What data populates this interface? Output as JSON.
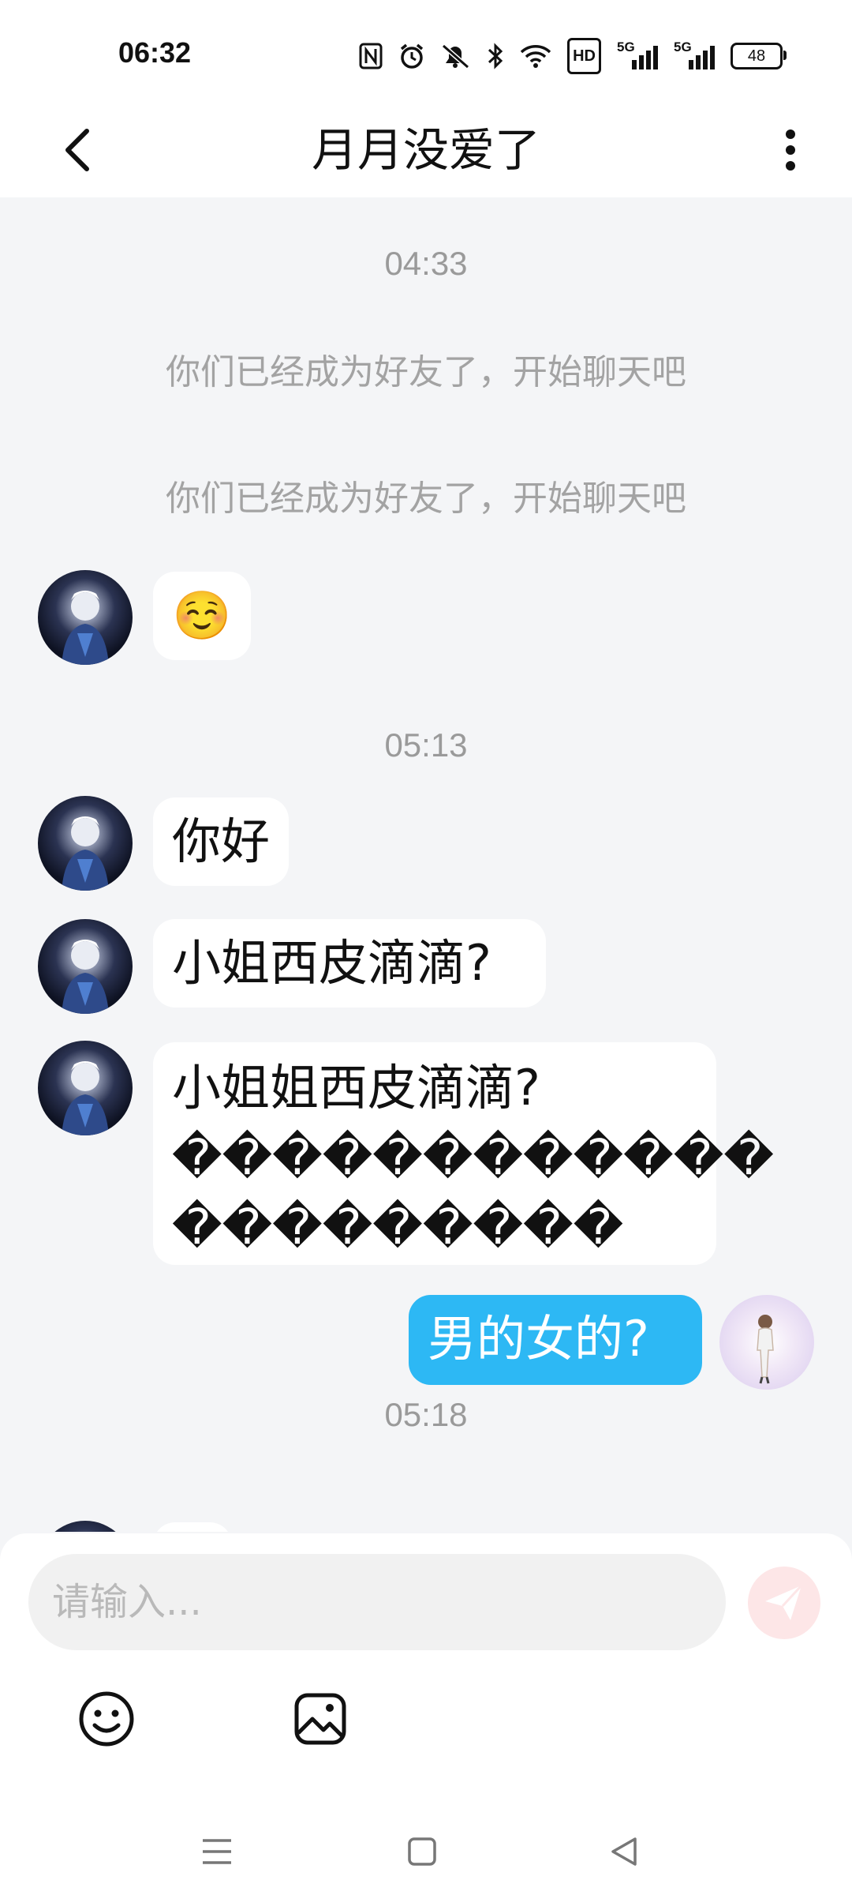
{
  "status_bar": {
    "time": "06:32",
    "icons": [
      "nfc-icon",
      "alarm-icon",
      "mute-icon",
      "bluetooth-icon",
      "wifi-icon"
    ],
    "hd_label": "HD",
    "signal1_label": "5G",
    "signal2_label": "5G",
    "battery": "48"
  },
  "header": {
    "title": "月月没爱了"
  },
  "messages": {
    "t1": "04:33",
    "sys1": "你们已经成为好友了，开始聊天吧",
    "sys2": "你们已经成为好友了，开始聊天吧",
    "m1": "☺️",
    "t2": "05:13",
    "m2": "你好",
    "m3": "小姐西皮滴滴?",
    "m4_line1": "小姐姐西皮滴滴?",
    "m4_line2": "������������",
    "m4_line3": "���������",
    "m5": "男的女的?",
    "t3": "05:18"
  },
  "composer": {
    "placeholder": "请输入..."
  },
  "colors": {
    "outgoing_bubble": "#2db8f4",
    "background": "#f4f5f7",
    "send_button": "#fde6e7"
  }
}
